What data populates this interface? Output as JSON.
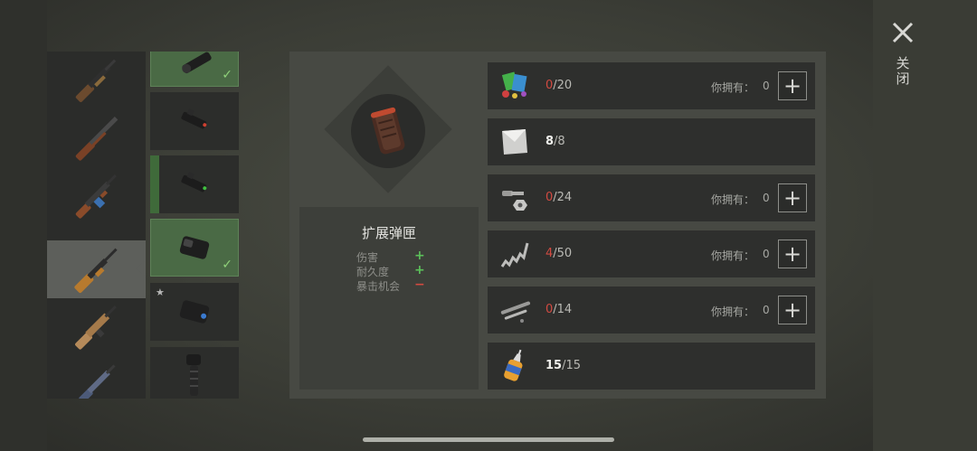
{
  "weapons": [
    {
      "name": "shotgun-pump-icon"
    },
    {
      "name": "shotgun-double-icon"
    },
    {
      "name": "assault-rifle-icon"
    },
    {
      "name": "rifle-wood-icon",
      "selected": true
    },
    {
      "name": "scar-rifle-icon"
    },
    {
      "name": "smg-icon"
    }
  ],
  "mods": [
    {
      "name": "scope-mod-icon",
      "equipped": true
    },
    {
      "name": "laser-mod-icon"
    },
    {
      "name": "laser-green-mod-icon"
    },
    {
      "name": "extended-mag-mod-icon",
      "equipped": true
    },
    {
      "name": "box-mod-icon",
      "starred": true
    },
    {
      "name": "grip-mod-icon"
    }
  ],
  "mod_marks": {
    "check": "✓",
    "star": "★"
  },
  "item": {
    "title": "扩展弹匣",
    "stats": [
      {
        "label": "伤害",
        "symbol": "+",
        "color": "#5cc05a"
      },
      {
        "label": "耐久度",
        "symbol": "+",
        "color": "#5cc05a"
      },
      {
        "label": "暴击机会",
        "symbol": "−",
        "color": "#d24a41"
      }
    ]
  },
  "resources": [
    {
      "icon": "cards-chips-icon",
      "have": "0",
      "need": "/20",
      "short": true,
      "owned_label": "你拥有：",
      "owned": "0",
      "plus": "+"
    },
    {
      "icon": "metal-plate-icon",
      "have": "8",
      "need": "/8",
      "short": false
    },
    {
      "icon": "nuts-bolts-icon",
      "have": "0",
      "need": "/24",
      "short": true,
      "owned_label": "你拥有：",
      "owned": "0",
      "plus": "+"
    },
    {
      "icon": "spring-icon",
      "have": "4",
      "need": "/50",
      "short": true,
      "owned_label": "你拥有：",
      "owned": "0",
      "plus": "+"
    },
    {
      "icon": "pipes-icon",
      "have": "0",
      "need": "/14",
      "short": true,
      "owned_label": "你拥有：",
      "owned": "0",
      "plus": "+"
    },
    {
      "icon": "glue-bottle-icon",
      "have": "15",
      "need": "/15",
      "short": false
    }
  ],
  "close": {
    "icon": "close-icon",
    "label": "关闭"
  }
}
